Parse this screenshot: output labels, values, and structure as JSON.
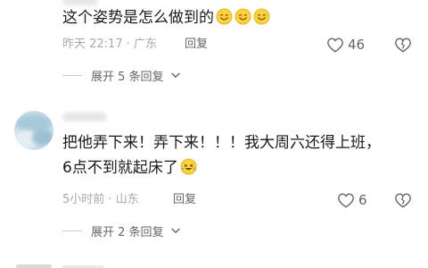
{
  "comments": [
    {
      "text": "这个姿势是怎么做到的",
      "emojis": [
        "smile-emoji",
        "smile-emoji",
        "smile-emoji"
      ],
      "time": "昨天 22:17",
      "location": "广东",
      "reply_label": "回复",
      "like_count": "46",
      "expand_label": "展开 5 条回复"
    },
    {
      "text_line1": "把他弄下来！弄下来！！！我大周六还得上班，",
      "text_line2": "6点不到就起床了",
      "emojis": [
        "laugh-cry-emoji"
      ],
      "time": "5小时前",
      "location": "山东",
      "reply_label": "回复",
      "like_count": "6",
      "expand_label": "展开 2 条回复"
    }
  ],
  "colors": {
    "text": "#1a1a1a",
    "meta": "#a8a8a8",
    "secondary": "#666666",
    "emoji_yellow": "#ffd23f"
  }
}
